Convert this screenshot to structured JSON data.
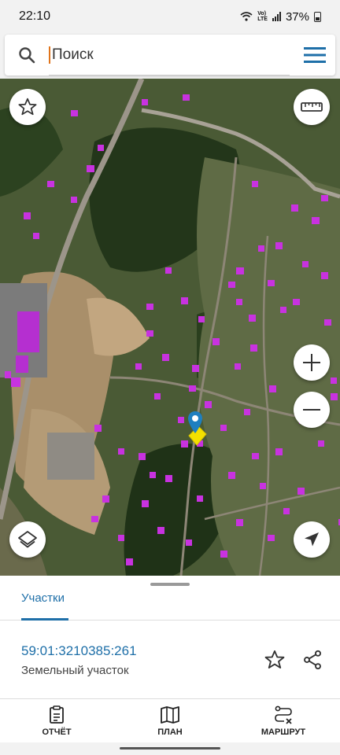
{
  "status": {
    "time": "22:10",
    "battery": "37%"
  },
  "search": {
    "placeholder": "Поиск"
  },
  "map": {
    "pin_color": "#1e7fc0",
    "parcel_color": "#f3e000",
    "building_color": "#c832e0"
  },
  "sheet": {
    "tab_label": "Участки",
    "parcel_id": "59:01:3210385:261",
    "parcel_type": "Земельный участок"
  },
  "nav": {
    "report_label": "ОТЧЁТ",
    "plan_label": "ПЛАН",
    "route_label": "МАРШРУТ"
  }
}
